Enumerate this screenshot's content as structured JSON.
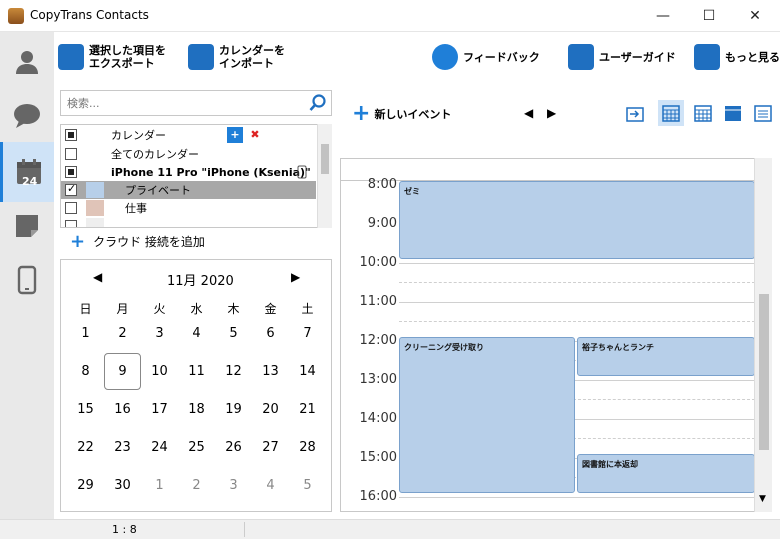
{
  "window": {
    "title": "CopyTrans Contacts",
    "minimize": "—",
    "maximize": "☐",
    "close": "✕"
  },
  "sidebar": {
    "items": [
      {
        "name": "contacts",
        "icon": "person-icon"
      },
      {
        "name": "messages",
        "icon": "speech-bubble-icon"
      },
      {
        "name": "calendar",
        "icon": "calendar-icon",
        "label": "24",
        "active": true
      },
      {
        "name": "notes",
        "icon": "note-icon"
      },
      {
        "name": "device",
        "icon": "phone-icon"
      }
    ]
  },
  "toolbar": {
    "export_label": "選択した項目を\nエクスポート",
    "import_label": "カレンダーを\nインポート",
    "feedback_label": "フィードバック",
    "guide_label": "ユーザーガイド",
    "more_label": "もっと見る"
  },
  "search": {
    "placeholder": "検索..."
  },
  "calendar_list": {
    "header": "カレンダー",
    "all": "全てのカレンダー",
    "device": "iPhone 11 Pro \"iPhone (Ksenia)\"",
    "items": [
      {
        "label": "プライベート",
        "color": "#b7cfe9",
        "checked": true
      },
      {
        "label": "仕事",
        "color": "#e0c4b8",
        "checked": false
      }
    ],
    "add_icon": "+",
    "delete_icon": "✖"
  },
  "add_cloud_label": "クラウド 接続を追加",
  "minical": {
    "month": "11月 2020",
    "prev": "◀",
    "next": "▶",
    "dow": [
      "日",
      "月",
      "火",
      "水",
      "木",
      "金",
      "土"
    ],
    "weeks": [
      [
        "1",
        "2",
        "3",
        "4",
        "5",
        "6",
        "7"
      ],
      [
        "8",
        "9",
        "10",
        "11",
        "12",
        "13",
        "14"
      ],
      [
        "15",
        "16",
        "17",
        "18",
        "19",
        "20",
        "21"
      ],
      [
        "22",
        "23",
        "24",
        "25",
        "26",
        "27",
        "28"
      ],
      [
        "29",
        "30",
        "1",
        "2",
        "3",
        "4",
        "5"
      ]
    ],
    "selected": "9"
  },
  "cal_toolbar": {
    "new_event_label": "新しいイベント",
    "prev": "◀",
    "next": "▶"
  },
  "day_view": {
    "hours": [
      "8:00",
      "9:00",
      "10:00",
      "11:00",
      "12:00",
      "13:00",
      "14:00",
      "15:00",
      "16:00"
    ],
    "events": [
      {
        "title": "ゼミ",
        "start": "8:00",
        "end": "10:00"
      },
      {
        "title": "クリーニング受け取り",
        "start": "12:00",
        "end": "16:00"
      },
      {
        "title": "裕子ちゃんとランチ",
        "start": "12:00",
        "end": "13:00"
      },
      {
        "title": "図書館に本返却",
        "start": "15:00",
        "end": "16:00"
      }
    ]
  },
  "status": {
    "zoom": "1 : 8"
  },
  "colors": {
    "accent": "#1f7fd8",
    "sidebar": "#e9e9e9",
    "event": "#b7cfe9"
  }
}
